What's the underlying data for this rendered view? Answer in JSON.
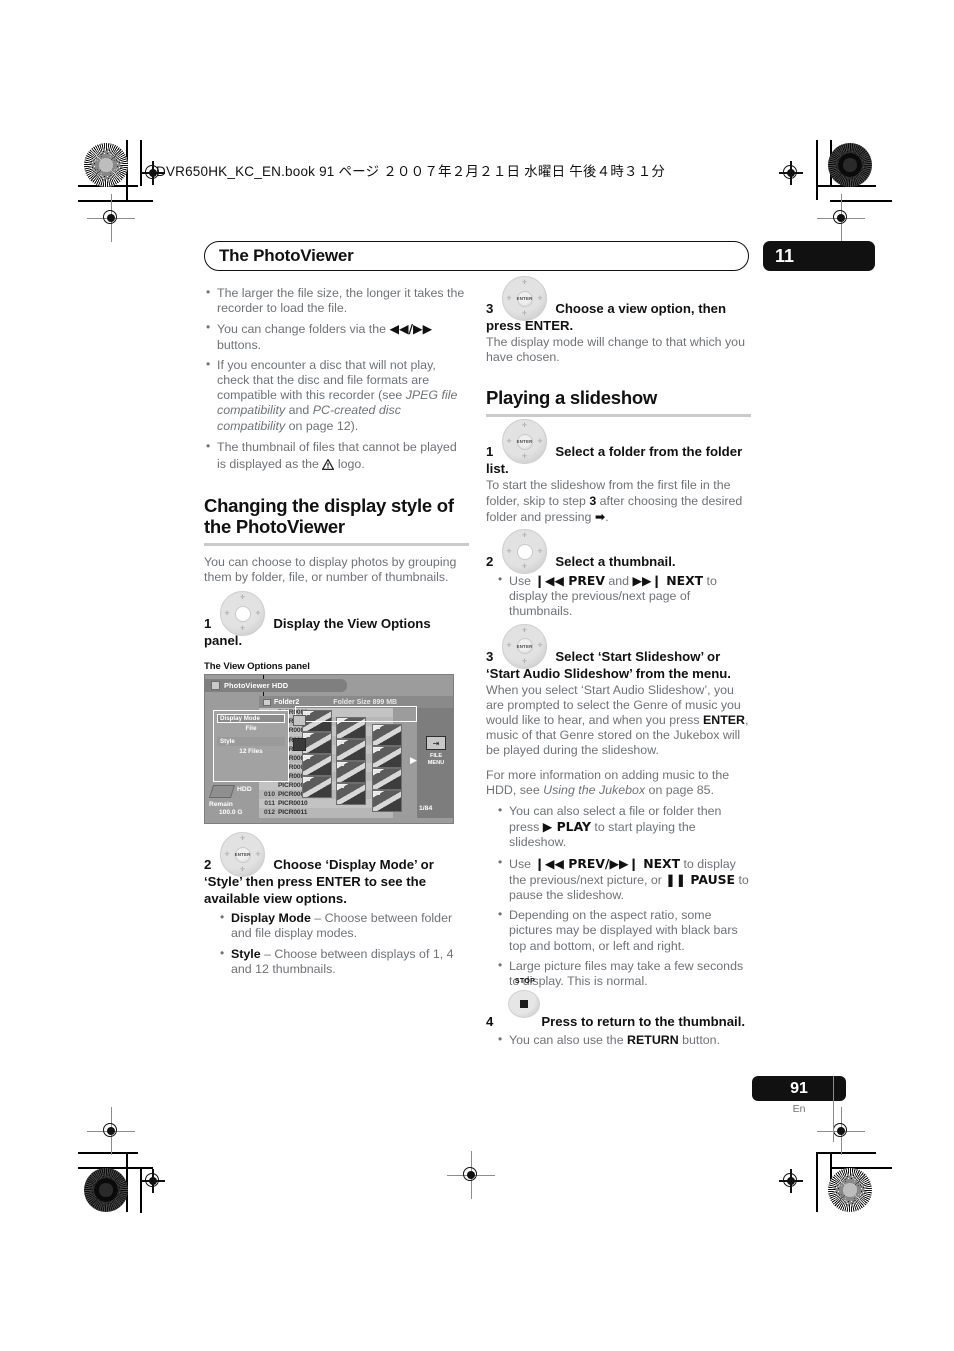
{
  "print": {
    "book_line": "DVR650HK_KC_EN.book  91 ページ  ２００７年２月２１日  水曜日  午後４時３１分"
  },
  "running_head": {
    "title": "The PhotoViewer",
    "chapter": "11"
  },
  "page_footer": {
    "number": "91",
    "language": "En"
  },
  "left_column": {
    "intro_bullets": [
      "The larger the file size, the longer it takes the recorder to load the file.",
      "You can change folders via the ◀◀/▶▶ buttons.",
      "If you encounter a disc that will not play, check that the disc and file formats are compatible with this recorder (see JPEG file compatibility and PC-created disc compatibility on page 12).",
      "The thumbnail of files that cannot be played is displayed as the ⚠ logo."
    ],
    "section": {
      "heading": "Changing the display style of the PhotoViewer",
      "intro": "You can choose to display photos by grouping them by folder, file, or number of thumbnails."
    },
    "step1": {
      "num": "1",
      "text": "Display the View Options panel."
    },
    "screenshot_caption": "The View Options panel",
    "step2": {
      "num": "2",
      "text": "Choose ‘Display Mode’ or ‘Style’ then press ENTER to see the available view options.",
      "bullets": [
        {
          "term": "Display Mode",
          "desc": " – Choose between folder and file display modes."
        },
        {
          "term": "Style",
          "desc": " – Choose between displays of 1, 4 and 12 thumbnails."
        }
      ]
    }
  },
  "screenshot": {
    "title": "PhotoViewer  HDD",
    "folder_name": "Folder2",
    "folder_size": "Folder Size 899 MB",
    "options_panel": {
      "display_mode_label": "Display Mode",
      "display_mode_value": "File",
      "style_label": "Style",
      "style_value": "12 Files"
    },
    "file_rows": [
      {
        "idx": "",
        "name": "PICR0000"
      },
      {
        "idx": "",
        "name": "PICR0001"
      },
      {
        "idx": "",
        "name": "PICR0002"
      },
      {
        "idx": "",
        "name": "PICR0003"
      },
      {
        "idx": "",
        "name": "PICR0004"
      },
      {
        "idx": "",
        "name": "PICR0005"
      },
      {
        "idx": "",
        "name": "PICR0006"
      },
      {
        "idx": "",
        "name": "PICR0007"
      },
      {
        "idx": "",
        "name": "PICR0008"
      },
      {
        "idx": "010",
        "name": "PICR0009"
      },
      {
        "idx": "011",
        "name": "PICR0010"
      },
      {
        "idx": "012",
        "name": "PICR0011"
      }
    ],
    "right_panel": {
      "menu_label": "FILE\nMENU"
    },
    "hdd": {
      "label": "HDD",
      "remain_label": "Remain",
      "remain_value": "100.0 G"
    },
    "page_indicator": "1/84"
  },
  "right_column": {
    "step3": {
      "num": "3",
      "text": "Choose a view option, then press ENTER.",
      "body": "The display mode will change to that which you have chosen."
    },
    "section": {
      "heading": "Playing a slideshow"
    },
    "step1": {
      "num": "1",
      "text": "Select a folder from the folder list.",
      "body": "To start the slideshow from the first file in the folder, skip to step 3 after choosing the desired folder and pressing ➡."
    },
    "step2": {
      "num": "2",
      "text": "Select a thumbnail.",
      "bullets": [
        "Use ⏮◀◀ PREV and ▶▶⏭ NEXT to display the previous/next page of thumbnails."
      ]
    },
    "step3b": {
      "num": "3",
      "text": "Select ‘Start Slideshow’ or ‘Start Audio Slideshow’ from the menu.",
      "body1": "When you select ‘Start Audio Slideshow’, you are prompted to select the Genre of music you would like to hear, and when you press ENTER, music of that Genre stored on the Jukebox will be played during the slideshow.",
      "body2": "For more information on adding music to the HDD, see Using the Jukebox on page 85.",
      "bullets": [
        "You can also select a file or folder then press ▶ PLAY to start playing the slideshow.",
        "Use ⏮◀◀ PREV/▶▶⏭ NEXT to display the previous/next picture, or ❚❚ PAUSE to pause the slideshow.",
        "Depending on the aspect ratio, some pictures may be displayed with black bars top and bottom, or left and right.",
        "Large picture files may take a few seconds to display. This is normal."
      ]
    },
    "step4": {
      "num": "4",
      "icon_label": "STOP",
      "text": "Press to return to the thumbnail.",
      "bullets": [
        "You can also use the RETURN button."
      ]
    }
  }
}
